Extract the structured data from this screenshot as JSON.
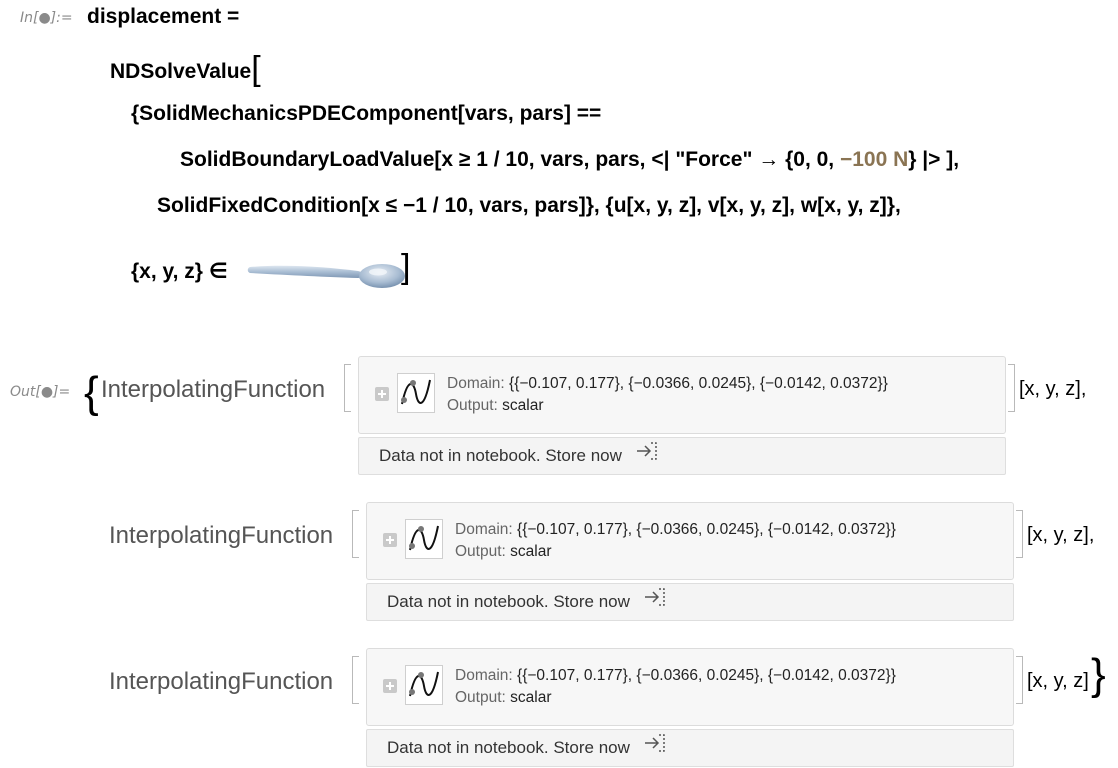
{
  "input": {
    "label": "In[●]:=",
    "line1": "displacement =",
    "line2": "NDSolveValue",
    "line3": "{SolidMechanicsPDEComponent[vars, pars] ==",
    "line4_pre": "SolidBoundaryLoadValue[x ≥ 1 / 10, vars, pars, <| \"Force\" → {0, 0,",
    "line4_qty": "−100 N",
    "line4_post": "} |> ],",
    "line5": "SolidFixedCondition[x ≤ −1 / 10, vars, pars]}, {u[x, y, z], v[x, y, z], w[x, y, z]},",
    "line6": "{x, y, z} ∈"
  },
  "output": {
    "label": "Out[●]=",
    "open_brace": "{",
    "close_brace": "}",
    "functions": [
      {
        "head": "InterpolatingFunction",
        "domain_key": "Domain:",
        "domain_value": "{{−0.107, 0.177}, {−0.0366, 0.0245}, {−0.0142, 0.0372}}",
        "output_key": "Output:",
        "output_value": "scalar",
        "store_text": "Data not in notebook. Store now",
        "tail": "[x, y, z],"
      },
      {
        "head": "InterpolatingFunction",
        "domain_key": "Domain:",
        "domain_value": "{{−0.107, 0.177}, {−0.0366, 0.0245}, {−0.0142, 0.0372}}",
        "output_key": "Output:",
        "output_value": "scalar",
        "store_text": "Data not in notebook. Store now",
        "tail": "[x, y, z],"
      },
      {
        "head": "InterpolatingFunction",
        "domain_key": "Domain:",
        "domain_value": "{{−0.107, 0.177}, {−0.0366, 0.0245}, {−0.0142, 0.0372}}",
        "output_key": "Output:",
        "output_value": "scalar",
        "store_text": "Data not in notebook. Store now",
        "tail": "[x, y, z]"
      }
    ]
  },
  "colors": {
    "quantity": "#8a7453",
    "label_gray": "#8a8a8a"
  },
  "icons": [
    "expand-plus-icon",
    "function-plot-icon",
    "store-arrow-icon",
    "spoon-region-icon"
  ]
}
